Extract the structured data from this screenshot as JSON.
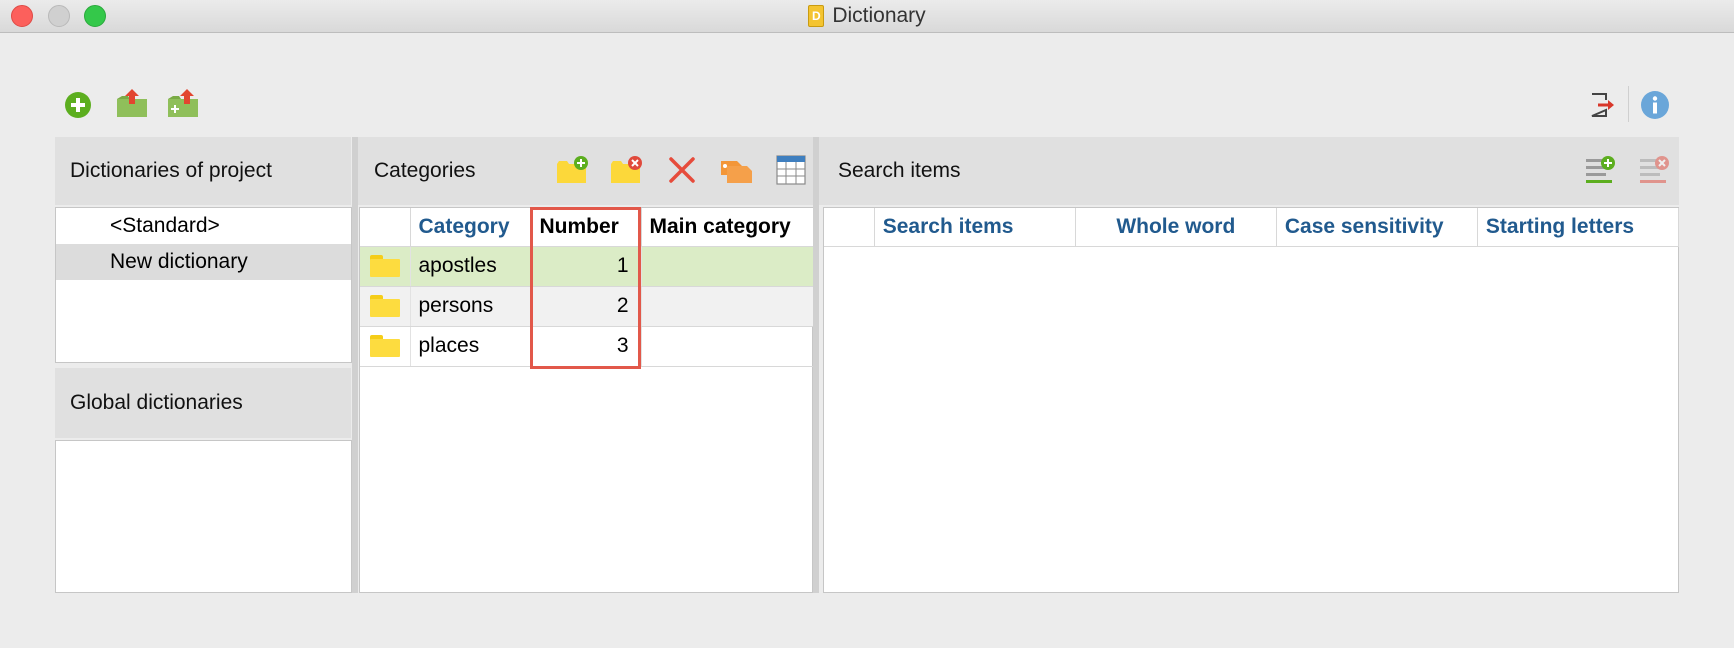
{
  "window": {
    "title": "Dictionary",
    "app_icon_letter": "D"
  },
  "toolbar": {
    "left_icons": [
      "add-circle-icon",
      "import-dictionary-icon",
      "export-dictionary-icon"
    ],
    "right_icons": [
      "exit-icon",
      "info-icon"
    ]
  },
  "dictionaries_panel": {
    "title": "Dictionaries of project",
    "items": [
      {
        "label": "<Standard>",
        "selected": false
      },
      {
        "label": "New dictionary",
        "selected": true
      }
    ]
  },
  "global_panel": {
    "title": "Global dictionaries",
    "items": []
  },
  "categories_panel": {
    "title": "Categories",
    "tool_icons": [
      "folder-add-icon",
      "folder-remove-icon",
      "delete-icon",
      "tag-icon",
      "table-icon"
    ],
    "columns": [
      "Category",
      "Number",
      "Main category"
    ],
    "rows": [
      {
        "category": "apostles",
        "number": "1",
        "main_category": "",
        "selected": true
      },
      {
        "category": "persons",
        "number": "2",
        "main_category": ""
      },
      {
        "category": "places",
        "number": "3",
        "main_category": ""
      }
    ]
  },
  "search_panel": {
    "title": "Search items",
    "tool_icons": [
      "list-add-icon",
      "list-remove-icon"
    ],
    "columns": [
      "Search items",
      "Whole word",
      "Case sensitivity",
      "Starting letters"
    ],
    "rows": []
  },
  "colors": {
    "accent_header": "#215a8e",
    "selected_row": "#dbecc6",
    "highlight": "#e2584a"
  }
}
